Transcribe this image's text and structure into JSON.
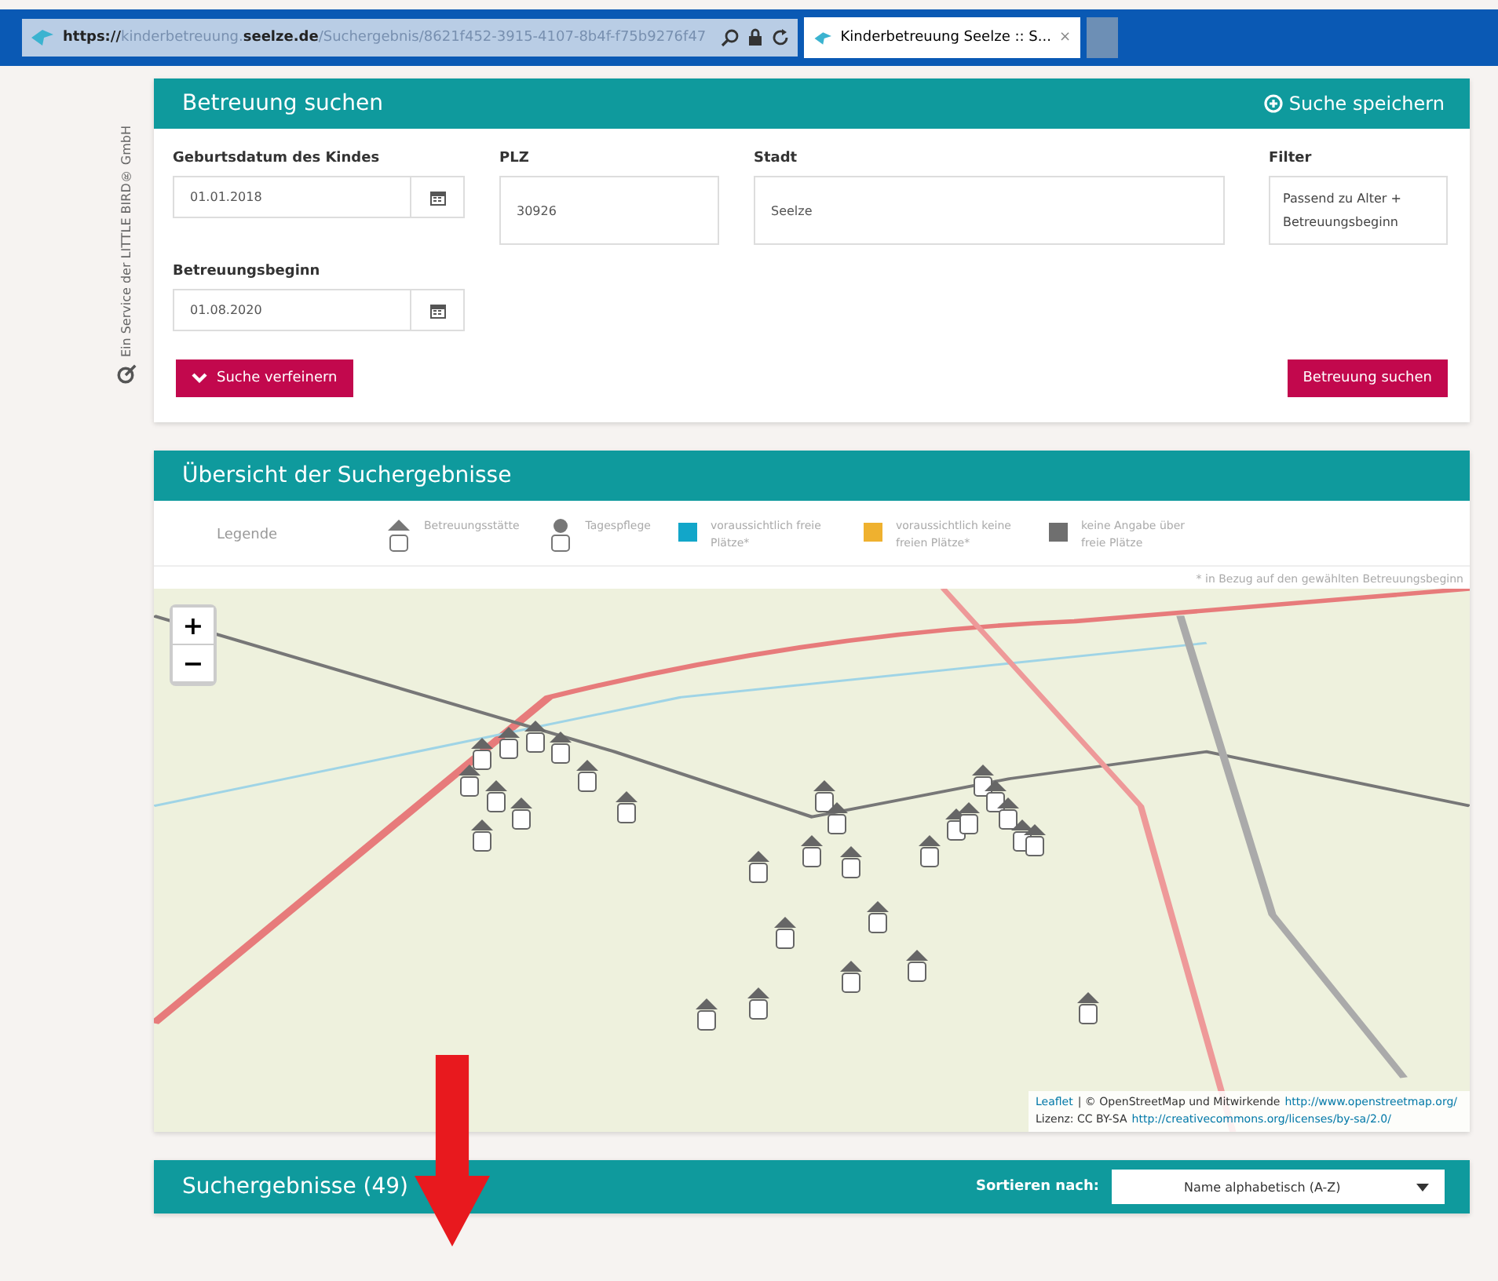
{
  "browser": {
    "url_scheme": "https://",
    "url_host": "kinderbetreuung.seelze.de",
    "url_path": "/Suchergebnis/8621f452-3915-4107-8b4f-f75b9276f47",
    "tab": {
      "title": "Kinderbetreuung Seelze :: S...",
      "close": "×"
    }
  },
  "brand_note": "Ein Service der LITTLE BIRD® GmbH",
  "search_panel": {
    "title": "Betreuung suchen",
    "save_link": "Suche speichern",
    "fields": [
      {
        "kind": "date",
        "label": "Geburtsdatum des Kindes",
        "value": "01.01.2018"
      },
      {
        "kind": "text",
        "label": "PLZ",
        "value": "30926"
      },
      {
        "kind": "text",
        "label": "Stadt",
        "value": "Seelze"
      },
      {
        "kind": "select",
        "label": "Filter",
        "value": "Passend zu Alter + Betreuungsbeginn"
      },
      {
        "kind": "date",
        "label": "Betreuungsbeginn",
        "value": "01.08.2020"
      }
    ],
    "refine_button": "Suche verfeinern",
    "search_button": "Betreuung suchen"
  },
  "overview": {
    "title": "Übersicht der Suchergebnisse",
    "legend_label": "Legende",
    "legend": [
      {
        "kind": "facility",
        "label": "Betreuungsstätte"
      },
      {
        "kind": "daycare",
        "label": "Tagespflege"
      },
      {
        "kind": "swatch",
        "color": "#12a6c9",
        "label": "voraussichtlich freie Plätze*"
      },
      {
        "kind": "swatch",
        "color": "#efb12f",
        "label": "voraussichtlich keine freien Plätze*"
      },
      {
        "kind": "swatch",
        "color": "#6f6f6f",
        "label": "keine Angabe über freie Plätze"
      }
    ],
    "footnote": "* in Bezug auf den gewählten Betreuungsbeginn",
    "map": {
      "zoom_in": "+",
      "zoom_out": "−",
      "attribution": [
        {
          "kind": "link",
          "text": "Leaflet"
        },
        {
          "kind": "text",
          "text": "| © OpenStreetMap und Mitwirkende"
        },
        {
          "kind": "link",
          "text": "http://www.openstreetmap.org/"
        },
        {
          "kind": "break"
        },
        {
          "kind": "text",
          "text": "Lizenz: CC BY-SA"
        },
        {
          "kind": "link",
          "text": "http://creativecommons.org/licenses/by-sa/2.0/"
        }
      ]
    }
  },
  "results": {
    "title": "Suchergebnisse (49)",
    "sort_label": "Sortieren nach:",
    "sort_value": "Name alphabetisch (A-Z)"
  }
}
